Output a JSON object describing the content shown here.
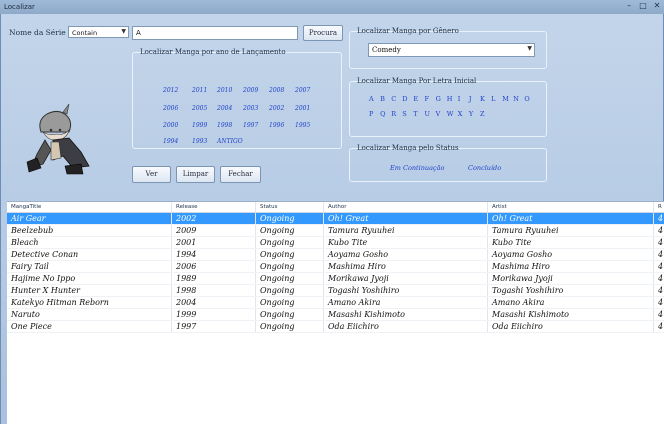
{
  "window": {
    "title": "Localizar",
    "minimize": "–",
    "maximize": "□",
    "close": "✕"
  },
  "search": {
    "label": "Nome da Série",
    "mode": "Contain",
    "value": "A",
    "button": "Procura"
  },
  "year_group": {
    "title": "Localizar Manga por ano de Lançamento",
    "years": [
      [
        "2012",
        "2011",
        "2010",
        "2009",
        "2008",
        "2007"
      ],
      [
        "2006",
        "2005",
        "2004",
        "2003",
        "2002",
        "2001"
      ],
      [
        "2000",
        "1999",
        "1998",
        "1997",
        "1996",
        "1995"
      ],
      [
        "1994",
        "1993",
        "ANTIGO"
      ]
    ]
  },
  "genre_group": {
    "title": "Localizar Manga por Gênero",
    "selected": "Comedy"
  },
  "letter_group": {
    "title": "Localizar Manga Por Letra Inicial",
    "rows": [
      [
        "A",
        "B",
        "C",
        "D",
        "E",
        "F",
        "G",
        "H",
        "I",
        "J",
        "K",
        "L",
        "M",
        "N",
        "O"
      ],
      [
        "P",
        "Q",
        "R",
        "S",
        "T",
        "U",
        "V",
        "W",
        "X",
        "Y",
        "Z"
      ]
    ]
  },
  "status_group": {
    "title": "Localizar Manga pelo Status",
    "options": [
      "Em Continuação",
      "Concluído"
    ]
  },
  "buttons": {
    "ver": "Ver",
    "limpar": "Limpar",
    "fechar": "Fechar"
  },
  "grid": {
    "columns": [
      "MangaTitle",
      "Release",
      "Status",
      "Author",
      "Artist",
      "R"
    ],
    "rows": [
      [
        "Air Gear",
        "2002",
        "Ongoing",
        "Oh! Great",
        "Oh! Great",
        "4"
      ],
      [
        "Beelzebub",
        "2009",
        "Ongoing",
        "Tamura Ryuuhei",
        "Tamura Ryuuhei",
        "4"
      ],
      [
        "Bleach",
        "2001",
        "Ongoing",
        "Kubo Tite",
        "Kubo Tite",
        "4"
      ],
      [
        "Detective Conan",
        "1994",
        "Ongoing",
        "Aoyama Gosho",
        "Aoyama Gosho",
        "4"
      ],
      [
        "Fairy Tail",
        "2006",
        "Ongoing",
        "Mashima Hiro",
        "Mashima Hiro",
        "4"
      ],
      [
        "Hajime No Ippo",
        "1989",
        "Ongoing",
        "Morikawa Jyoji",
        "Morikawa Jyoji",
        "4"
      ],
      [
        "Hunter X Hunter",
        "1998",
        "Ongoing",
        "Togashi Yoshihiro",
        "Togashi Yoshihiro",
        "4"
      ],
      [
        "Katekyo Hitman Reborn",
        "2004",
        "Ongoing",
        "Amano Akira",
        "Amano Akira",
        "4"
      ],
      [
        "Naruto",
        "1999",
        "Ongoing",
        "Masashi Kishimoto",
        "Masashi Kishimoto",
        "4"
      ],
      [
        "One Piece",
        "1997",
        "Ongoing",
        "Oda Eiichiro",
        "Oda Eiichiro",
        "4"
      ]
    ],
    "selected_row": 0
  }
}
